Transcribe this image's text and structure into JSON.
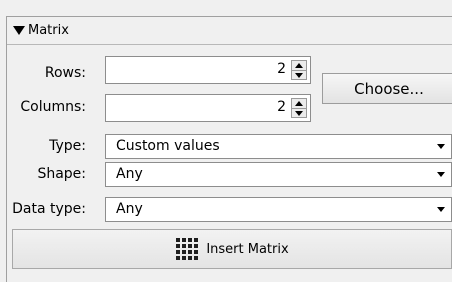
{
  "panel": {
    "header_label": "Matrix"
  },
  "rows": {
    "label": "Rows:",
    "value": "2"
  },
  "columns": {
    "label": "Columns:",
    "value": "2"
  },
  "choose_button": "Choose...",
  "type": {
    "label": "Type:",
    "value": "Custom values"
  },
  "shape": {
    "label": "Shape:",
    "value": "Any"
  },
  "data_type": {
    "label": "Data type:",
    "value": "Any"
  },
  "insert_button": "Insert Matrix"
}
